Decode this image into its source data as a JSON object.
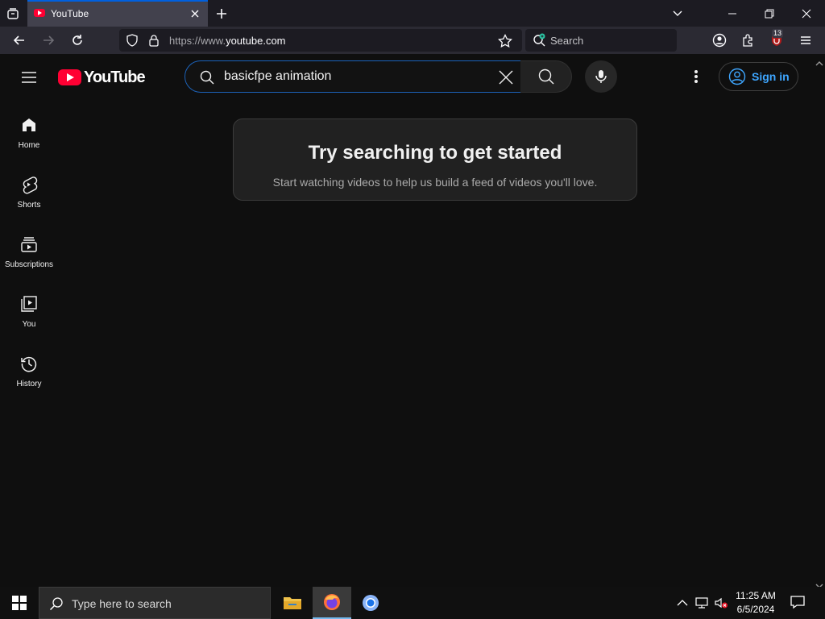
{
  "browser": {
    "tab_title": "YouTube",
    "url_prefix": "https://www.",
    "url_domain": "youtube.com",
    "search_placeholder": "Search",
    "extension_badge": "13"
  },
  "youtube": {
    "logo_text": "YouTube",
    "search_query": "basicfpe animation",
    "signin_label": "Sign in",
    "nav": [
      {
        "label": "Home",
        "icon": "home-icon"
      },
      {
        "label": "Shorts",
        "icon": "shorts-icon"
      },
      {
        "label": "Subscriptions",
        "icon": "subscriptions-icon"
      },
      {
        "label": "You",
        "icon": "you-icon"
      },
      {
        "label": "History",
        "icon": "history-icon"
      }
    ],
    "prompt": {
      "title": "Try searching to get started",
      "subtitle": "Start watching videos to help us build a feed of videos you'll love."
    },
    "accent_color": "#3ea6ff",
    "brand_color": "#ff0033"
  },
  "taskbar": {
    "search_placeholder": "Type here to search",
    "time": "11:25 AM",
    "date": "6/5/2024"
  }
}
